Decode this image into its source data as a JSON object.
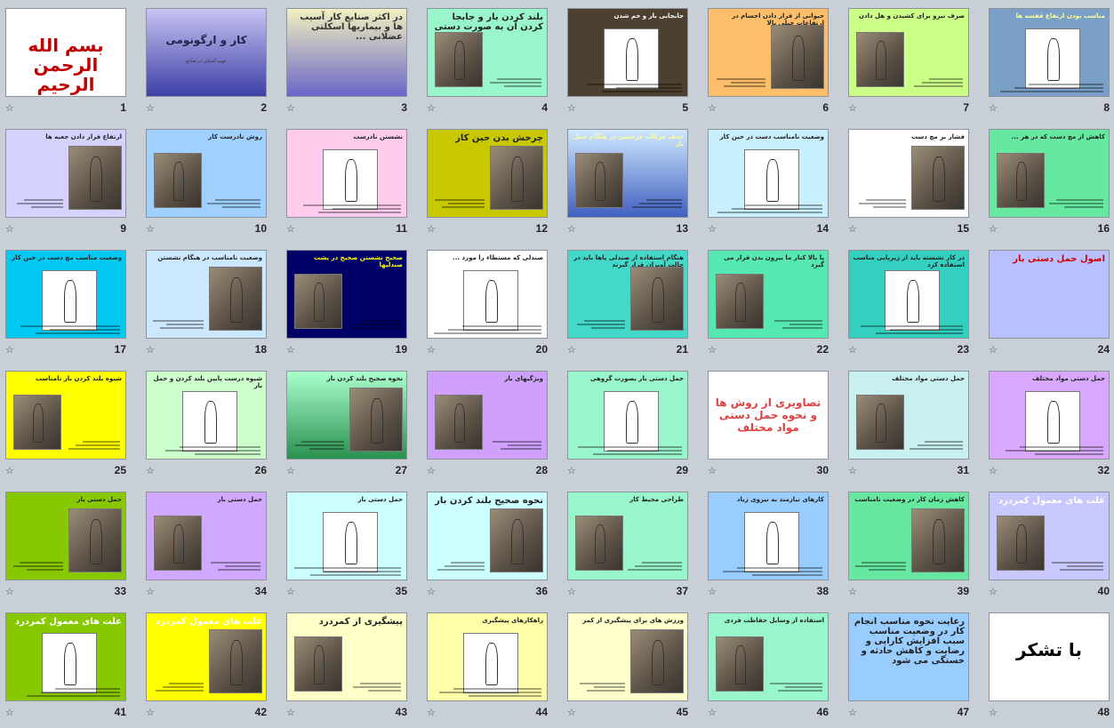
{
  "app": {
    "star_icon": "star-outline-icon",
    "bg_color": "#c9cfd6"
  },
  "slides": [
    {
      "number": "1",
      "title": "بسم الله الرحمن الرحیم",
      "bg": "#ffffff",
      "title_color": "#c00000",
      "style": "huge",
      "pic": false
    },
    {
      "number": "2",
      "title": "کار و ارگونومی",
      "subtitle": "جهت آشنایی در صنایع",
      "bg": "linear-gradient(#c7c3f2,#3d3fa6)",
      "title_color": "#22224a",
      "style": "big",
      "pic": false
    },
    {
      "number": "3",
      "title": "در اکثر صنایع کار آسیب ها و بیماریها اسکلتی عضلانی ...",
      "bg": "linear-gradient(#f2f0c0,#6a66c8)",
      "title_color": "#333",
      "style": "mid",
      "pic": false
    },
    {
      "number": "4",
      "title": "بلند کردن بار و جابجا کردن آن به صورت دستی",
      "bg": "#99f5cc",
      "title_color": "#222",
      "style": "mid",
      "pic": true
    },
    {
      "number": "5",
      "title": "جابجایی بار و خم شدن",
      "bg": "#4d4030",
      "title_color": "#ffffff",
      "style": "small",
      "pic": true
    },
    {
      "number": "6",
      "title": "حیوانی از قرار دادن اجسام در ارتفاعات خیلی بالا",
      "bg": "#ffbf6a",
      "title_color": "#222",
      "style": "small",
      "pic": true
    },
    {
      "number": "7",
      "title": "صرف نیرو برای کشیدن و هل دادن",
      "bg": "#ccff88",
      "title_color": "#222",
      "style": "small",
      "pic": true
    },
    {
      "number": "8",
      "title": "مناسب بودن ارتفاع قفسه ها",
      "bg": "#7aa0c8",
      "title_color": "#ffff99",
      "style": "small",
      "pic": true
    },
    {
      "number": "9",
      "title": "ارتفاع قرار دادن جعبه ها",
      "bg": "#d5d2ff",
      "title_color": "#222",
      "style": "small",
      "pic": true
    },
    {
      "number": "10",
      "title": "روش نادرست کار",
      "bg": "#9fd0ff",
      "title_color": "#222",
      "style": "small",
      "pic": true
    },
    {
      "number": "11",
      "title": "نشستن نادرست",
      "bg": "#ffccee",
      "title_color": "#222",
      "style": "small",
      "pic": true
    },
    {
      "number": "12",
      "title": "چرخش بدن حین کار",
      "bg": "#c8c800",
      "title_color": "#222",
      "style": "mid",
      "pic": true
    },
    {
      "number": "13",
      "title": "حذف حرکات چرخشی در هنگام حمل بار",
      "bg": "linear-gradient(#d0e8ff,#4060c0)",
      "title_color": "#ffff99",
      "style": "small",
      "pic": true
    },
    {
      "number": "14",
      "title": "وضعیت نامناسب دست در حین کار",
      "bg": "#c8f0ff",
      "title_color": "#222",
      "style": "small",
      "pic": true
    },
    {
      "number": "15",
      "title": "فشار بر مچ دست",
      "bg": "#ffffff",
      "title_color": "#222",
      "style": "small",
      "pic": true
    },
    {
      "number": "16",
      "title": "کاهش از مچ دست که در هر ...",
      "bg": "#66e8a0",
      "title_color": "#222",
      "style": "small",
      "pic": true
    },
    {
      "number": "17",
      "title": "وضعیت مناسب مچ دست در حین کار",
      "bg": "#00c8f0",
      "title_color": "#222",
      "style": "small",
      "pic": true
    },
    {
      "number": "18",
      "title": "وضعیت نامناسب در هنگام نشستن",
      "bg": "#cce8ff",
      "title_color": "#222",
      "style": "small",
      "pic": true
    },
    {
      "number": "19",
      "title": "صحیح نشستن صحیح در پشت صندلیها",
      "bg": "#000066",
      "title_color": "#ffff00",
      "style": "small",
      "pic": true
    },
    {
      "number": "20",
      "title": "صندلی که مستطاء را مورد ...",
      "bg": "#ffffff",
      "title_color": "#222",
      "style": "small",
      "pic": true
    },
    {
      "number": "21",
      "title": "هنگام استفاده از صندلی پاها باید در حالت آویزان قرار گیرند",
      "bg": "#44d8c8",
      "title_color": "#222",
      "style": "small",
      "pic": true
    },
    {
      "number": "22",
      "title": "پا بالا کنار ما بیرون بدن قرار می گیرد",
      "bg": "#55e8b0",
      "title_color": "#222",
      "style": "small",
      "pic": true
    },
    {
      "number": "23",
      "title": "در کار نشسته باید از زیرپایی مناسب استفاده کرد",
      "bg": "#33d0c0",
      "title_color": "#222",
      "style": "small",
      "pic": true
    },
    {
      "number": "24",
      "title": "اصول حمل دستی بار",
      "bg": "#b8c0ff",
      "title_color": "#d00000",
      "style": "mid",
      "pic": false
    },
    {
      "number": "25",
      "title": "شیوه بلند کردن بار نامناسب",
      "bg": "#ffff00",
      "title_color": "#222",
      "style": "small",
      "pic": true
    },
    {
      "number": "26",
      "title": "شیوه درست پایین بلند کردن و حمل بار",
      "bg": "#ccffcc",
      "title_color": "#222",
      "style": "small",
      "pic": true
    },
    {
      "number": "27",
      "title": "نحوه صحیح بلند کردن بار",
      "bg": "linear-gradient(#aaffcc,#2a9050)",
      "title_color": "#222",
      "style": "small",
      "pic": true
    },
    {
      "number": "28",
      "title": "ویژگیهای بار",
      "bg": "#d0a0ff",
      "title_color": "#222",
      "style": "small",
      "pic": true
    },
    {
      "number": "29",
      "title": "حمل دستی بار بصورت گروهی",
      "bg": "#99f5cc",
      "title_color": "#222",
      "style": "small",
      "pic": true
    },
    {
      "number": "30",
      "title": "تصاویری از روش ها و نحوه حمل دستی مواد مختلف",
      "bg": "#ffffff",
      "title_color": "#e04040",
      "style": "big",
      "pic": false
    },
    {
      "number": "31",
      "title": "حمل دستی مواد مختلف",
      "bg": "#c8f0f0",
      "title_color": "#222",
      "style": "small",
      "pic": true
    },
    {
      "number": "32",
      "title": "حمل دستی مواد مختلف",
      "bg": "#d8a8ff",
      "title_color": "#222",
      "style": "small",
      "pic": true
    },
    {
      "number": "33",
      "title": "حمل دستی بار",
      "bg": "#88c800",
      "title_color": "#222",
      "style": "small",
      "pic": true
    },
    {
      "number": "34",
      "title": "حمل دستی بار",
      "bg": "#d0a8ff",
      "title_color": "#222",
      "style": "small",
      "pic": true
    },
    {
      "number": "35",
      "title": "حمل دستی بار",
      "bg": "#ccffff",
      "title_color": "#222",
      "style": "small",
      "pic": true
    },
    {
      "number": "36",
      "title": "نحوه صحیح بلند کردن بار",
      "bg": "#ccffff",
      "title_color": "#222",
      "style": "mid",
      "pic": true
    },
    {
      "number": "37",
      "title": "طراحی محیط کار",
      "bg": "#99f5cc",
      "title_color": "#222",
      "style": "small",
      "pic": true
    },
    {
      "number": "38",
      "title": "کارهای نیازمند به نیروی زیاد",
      "bg": "#99ccff",
      "title_color": "#222",
      "style": "small",
      "pic": true
    },
    {
      "number": "39",
      "title": "کاهش زمان کار در وضعیت نامناسب",
      "bg": "#66e8a0",
      "title_color": "#222",
      "style": "small",
      "pic": true
    },
    {
      "number": "40",
      "title": "علت های معمول کمردرد",
      "bg": "#c8c8ff",
      "title_color": "#ffffff",
      "style": "mid",
      "pic": true
    },
    {
      "number": "41",
      "title": "علت های معمول کمردرد",
      "bg": "#88c800",
      "title_color": "#ffffff",
      "style": "mid",
      "pic": true
    },
    {
      "number": "42",
      "title": "علت های معمول کمردرد",
      "bg": "#ffff00",
      "title_color": "#ffffff",
      "style": "mid",
      "pic": true
    },
    {
      "number": "43",
      "title": "پیشگیری از کمردرد",
      "bg": "#ffffc8",
      "title_color": "#222",
      "style": "mid",
      "pic": true
    },
    {
      "number": "44",
      "title": "راهکارهای پیشگیری",
      "bg": "#ffffaa",
      "title_color": "#222",
      "style": "small",
      "pic": true
    },
    {
      "number": "45",
      "title": "ورزش های برای پیشگیری از کمر",
      "bg": "#ffffcc",
      "title_color": "#222",
      "style": "small",
      "pic": true
    },
    {
      "number": "46",
      "title": "استفاده از وسایل حفاظت فردی",
      "bg": "#99f5cc",
      "title_color": "#222",
      "style": "small",
      "pic": true
    },
    {
      "number": "47",
      "title": "رعایت نحوه مناسب انجام کار در وضعیت مناسب سبب افزایش کارایی و رضایت و کاهش حادثه و خستگی می شود",
      "bg": "#99ccff",
      "title_color": "#222",
      "style": "mid",
      "pic": false
    },
    {
      "number": "48",
      "title": "با تشکر",
      "bg": "#ffffff",
      "title_color": "#000000",
      "style": "huge",
      "pic": false
    }
  ]
}
